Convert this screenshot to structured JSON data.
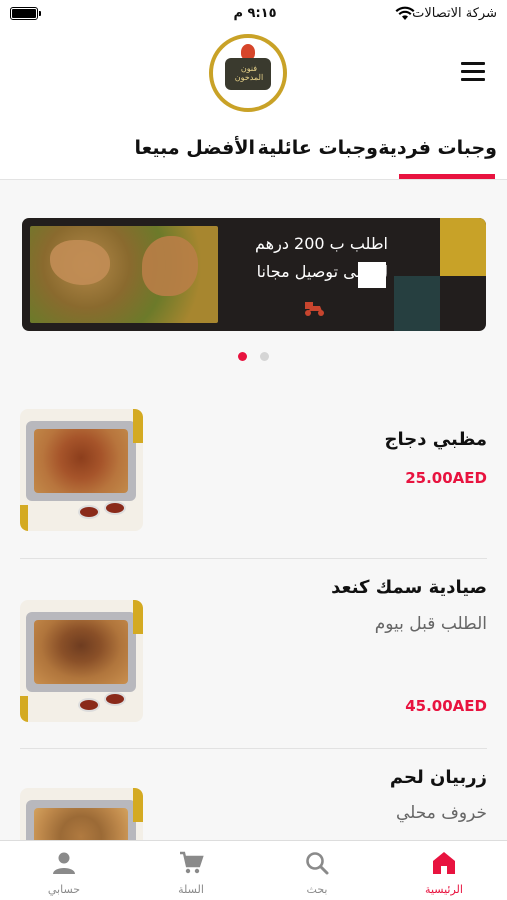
{
  "status_bar": {
    "time": "٩:١٥ م",
    "carrier": "شركة الاتصالات"
  },
  "header": {
    "logo_text": "فنون المدخون",
    "menu_icon": "hamburger-menu-icon"
  },
  "tabs": [
    {
      "label": "وجبات فردية",
      "active": true
    },
    {
      "label": "وجبات عائلية",
      "active": false
    },
    {
      "label": "الأفضل مبيعا",
      "active": false
    }
  ],
  "banner": {
    "line1": "اطلب ب 200 درهم",
    "line2": "ل على توصيل مجانا",
    "colors": {
      "background": "#221e1d",
      "gold": "#c8a228",
      "teal": "#263f40"
    }
  },
  "carousel": {
    "count": 2,
    "active_index": 0
  },
  "products": [
    {
      "name": "مظبي دجاج",
      "description": "",
      "price": "25.00AED"
    },
    {
      "name": "صيادية سمك كنعد",
      "description": "الطلب قبل بيوم",
      "price": "45.00AED"
    },
    {
      "name": "زربيان لحم",
      "description": "خروف محلي",
      "price": ""
    }
  ],
  "bottom_nav": [
    {
      "label": "الرئيسية",
      "icon": "home-icon",
      "active": true
    },
    {
      "label": "بحث",
      "icon": "search-icon",
      "active": false
    },
    {
      "label": "السلة",
      "icon": "cart-icon",
      "active": false
    },
    {
      "label": "حسابي",
      "icon": "user-icon",
      "active": false
    }
  ],
  "colors": {
    "accent": "#e8133f",
    "gold": "#c9a227"
  }
}
